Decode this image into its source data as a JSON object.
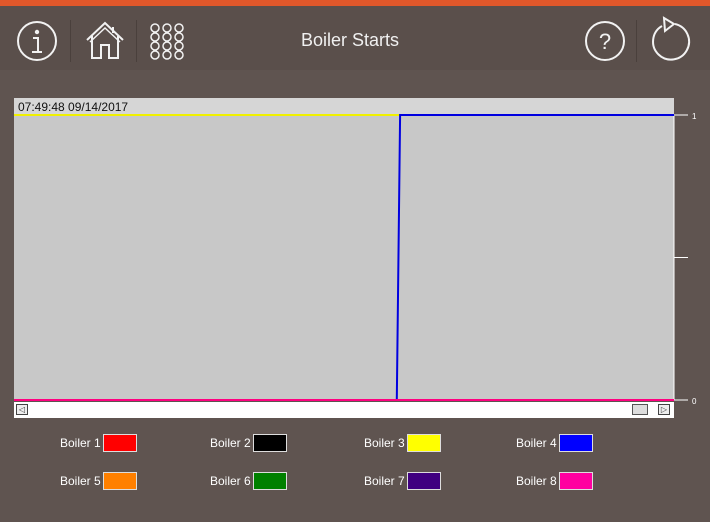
{
  "header": {
    "title": "Boiler Starts",
    "icons": [
      "info-icon",
      "home-icon",
      "menu-grid-icon",
      "help-icon",
      "back-icon"
    ]
  },
  "chart": {
    "timestamp": "07:49:48 09/14/2017"
  },
  "chart_data": {
    "type": "line",
    "y_ticks": [
      "1",
      "0"
    ],
    "ylim": [
      0,
      1
    ],
    "background": "#c8c8c8",
    "series": [
      {
        "name": "Boiler 3",
        "color": "#f0f000",
        "points": [
          [
            0,
            1
          ],
          [
            0.585,
            1
          ]
        ]
      },
      {
        "name": "Boiler 4",
        "color": "#0000e0",
        "points": [
          [
            0.58,
            0
          ],
          [
            0.585,
            1
          ],
          [
            1,
            1
          ]
        ]
      },
      {
        "name": "Boiler 8",
        "color": "#ff0080",
        "points": [
          [
            0,
            0
          ],
          [
            1,
            0
          ]
        ]
      }
    ]
  },
  "legend": [
    {
      "label": "Boiler 1",
      "color": "#ff0000"
    },
    {
      "label": "Boiler 2",
      "color": "#000000"
    },
    {
      "label": "Boiler 3",
      "color": "#ffff00"
    },
    {
      "label": "Boiler 4",
      "color": "#0000ff"
    },
    {
      "label": "Boiler 5",
      "color": "#ff8000"
    },
    {
      "label": "Boiler 6",
      "color": "#008000"
    },
    {
      "label": "Boiler 7",
      "color": "#400080"
    },
    {
      "label": "Boiler 8",
      "color": "#ff00a0"
    }
  ],
  "scrollbar": {
    "left_arrow": "◁",
    "right_arrow": "▷"
  }
}
